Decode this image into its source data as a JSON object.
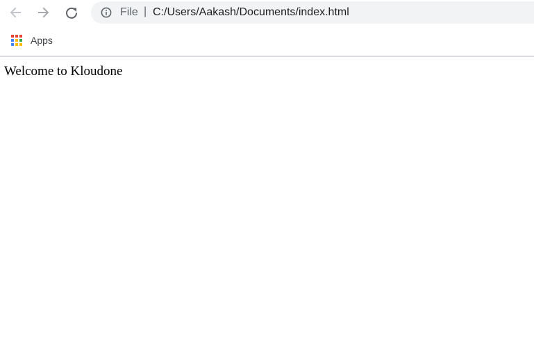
{
  "toolbar": {
    "back_icon": "arrow-left-icon",
    "forward_icon": "arrow-right-icon",
    "reload_icon": "reload-icon"
  },
  "omnibox": {
    "security_icon": "info-icon",
    "scheme_label": "File",
    "separator": "|",
    "url": "C:/Users/Aakash/Documents/index.html",
    "background_color": "#f1f3f4"
  },
  "bookmarks": {
    "items": [
      {
        "label": "Apps",
        "icon": "apps-grid-icon"
      }
    ]
  },
  "page": {
    "body_text": "Welcome to Kloudone"
  },
  "colors": {
    "nav_disabled": "#c1c4c8",
    "nav_enabled": "#5f6368",
    "apps_grid": [
      "#ea4335",
      "#fbbc04",
      "#34a853",
      "#4285f4"
    ]
  }
}
